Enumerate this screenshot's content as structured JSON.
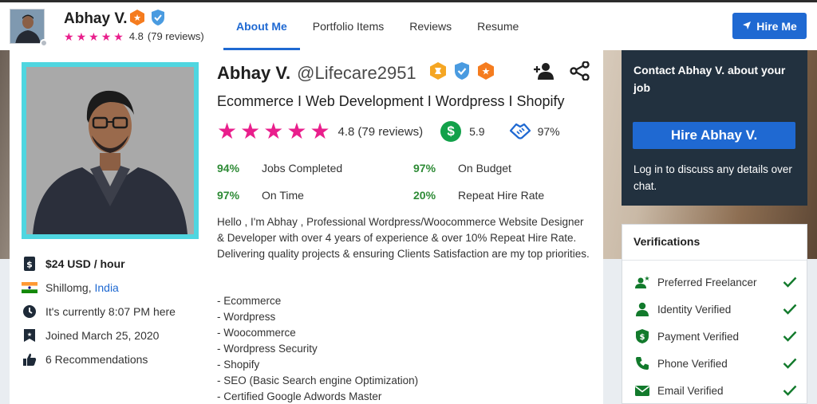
{
  "header": {
    "name": "Abhay V.",
    "rating_value": "4.8",
    "reviews": "(79 reviews)",
    "tabs": [
      "About Me",
      "Portfolio Items",
      "Reviews",
      "Resume"
    ],
    "hire_button": "Hire Me"
  },
  "profile": {
    "name": "Abhay V.",
    "username": "@Lifecare2951",
    "tagline": "Ecommerce I Web Development I Wordpress I Shopify",
    "rating_value": "4.8",
    "reviews": "(79 reviews)",
    "earnings_score": "5.9",
    "earnings_symbol": "$",
    "handshake_pct": "97%",
    "stats": [
      {
        "pct": "94%",
        "label": "Jobs Completed"
      },
      {
        "pct": "97%",
        "label": "On Budget"
      },
      {
        "pct": "97%",
        "label": "On Time"
      },
      {
        "pct": "20%",
        "label": "Repeat Hire Rate"
      }
    ],
    "bio": "Hello , I'm Abhay , Professional Wordpress/Woocommerce Website Designer & Developer with over 4 years of experience & over 10% Repeat Hire Rate. Delivering quality projects & ensuring Clients Satisfaction are my top priorities.",
    "skills": [
      "- Ecommerce",
      "- Wordpress",
      "- Woocommerce",
      "- Wordpress Security",
      "- Shopify",
      "- SEO (Basic Search engine Optimization)",
      "- Certified Google Adwords Master"
    ]
  },
  "left_info": {
    "rate": "$24 USD / hour",
    "city": "Shillomg,",
    "country": "India",
    "local_time": "It's currently 8:07 PM here",
    "joined": "Joined March 25, 2020",
    "recommendations": "6 Recommendations"
  },
  "contact": {
    "title": "Contact Abhay V. about your job",
    "hire_button": "Hire Abhay V.",
    "login_text": "Log in to discuss any details over chat."
  },
  "verifications": {
    "title": "Verifications",
    "items": [
      "Preferred Freelancer",
      "Identity Verified",
      "Payment Verified",
      "Phone Verified",
      "Email Verified"
    ]
  },
  "colors": {
    "accent": "#1f69d2",
    "star": "#e91e8c",
    "success": "#2e8b36",
    "dark_panel": "#22313f",
    "photo_frame": "#4fd6e0"
  }
}
